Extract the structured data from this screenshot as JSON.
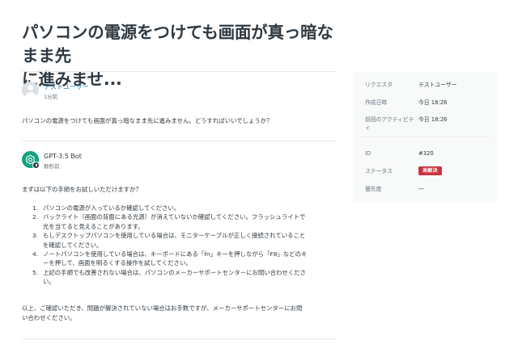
{
  "title_line1": "パソコンの電源をつけても画面が真っ暗なまま先",
  "title_line2": "に進みませ...",
  "question": {
    "author": "テストユーザー",
    "time": "1分前",
    "text": "パソコンの電源をつけても画面が真っ暗なまま先に進みません。どうすればいいでしょうか？"
  },
  "answer": {
    "author": "GPT-3.5 Bot",
    "time": "数秒前",
    "intro": "まずは以下の手順をお試しいただけますか？",
    "steps": [
      {
        "num": "1.",
        "lines": [
          "パソコンの電源が入っているか確認してください。"
        ]
      },
      {
        "num": "2.",
        "lines": [
          "バックライト（画面の背面にある光源）が消えていないか確認してください。フラッシュライトで",
          "光を当てると見えることがあります。"
        ]
      },
      {
        "num": "3.",
        "lines": [
          "もしデスクトップパソコンを使用している場合は、モニターケーブルが正しく接続されていること",
          "を確認してください。"
        ]
      },
      {
        "num": "4.",
        "lines": [
          "ノートパソコンを使用している場合は、キーボードにある「fn」キーを押しながら「F8」などのキ",
          "ーを押して、画面を明るくする操作を試してください。"
        ]
      },
      {
        "num": "5.",
        "lines": [
          "上記の手順でも改善されない場合は、パソコンのメーカーサポートセンターにお問い合わせくださ",
          "い。"
        ]
      }
    ],
    "outro_lines": [
      "以上、ご確認いただき、問題が解決されていない場合はお手数ですが、メーカーサポートセンターにお問",
      "い合わせください。"
    ]
  },
  "sidebar": {
    "requester_label": "リクエスタ",
    "requester_value": "テストユーザー",
    "created_label": "作成日時",
    "created_value": "今日 18:26",
    "last_activity_label": "前回のアクティビテ",
    "last_activity_label2": "ィ",
    "last_activity_value": "今日 18:26",
    "id_label": "ID",
    "id_value": "#320",
    "status_label": "ステータス",
    "status_value": "未解決",
    "priority_label": "優先度",
    "priority_value": "—"
  },
  "colors": {
    "link": "#1f73b7",
    "status_open": "#cc3340",
    "bot_green": "#10a37f"
  }
}
